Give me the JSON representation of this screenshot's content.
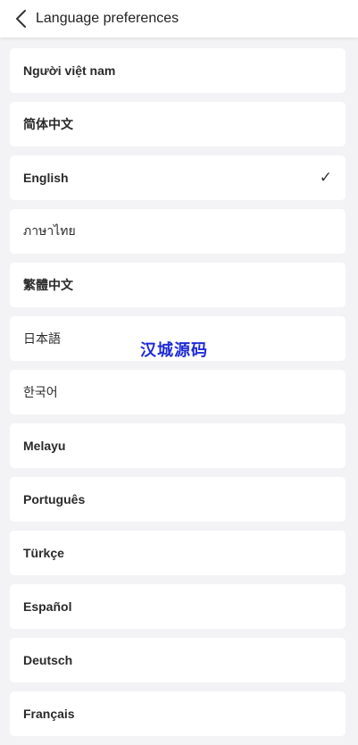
{
  "header": {
    "title": "Language preferences",
    "back_icon": "chevron-left-icon"
  },
  "languages": [
    {
      "label": "Người việt nam",
      "selected": false
    },
    {
      "label": "简体中文",
      "selected": false
    },
    {
      "label": "English",
      "selected": true
    },
    {
      "label": "ภาษาไทย",
      "selected": false
    },
    {
      "label": "繁體中文",
      "selected": false
    },
    {
      "label": "日本語",
      "selected": false
    },
    {
      "label": "한국어",
      "selected": false
    },
    {
      "label": "Melayu",
      "selected": false
    },
    {
      "label": "Português",
      "selected": false
    },
    {
      "label": "Türkçe",
      "selected": false
    },
    {
      "label": "Español",
      "selected": false
    },
    {
      "label": "Deutsch",
      "selected": false
    },
    {
      "label": "Français",
      "selected": false
    }
  ],
  "check_mark": "✓",
  "watermark": "汉城源码",
  "colors": {
    "background": "#f3f3f5",
    "card": "#ffffff",
    "watermark": "#1f2bd6"
  }
}
